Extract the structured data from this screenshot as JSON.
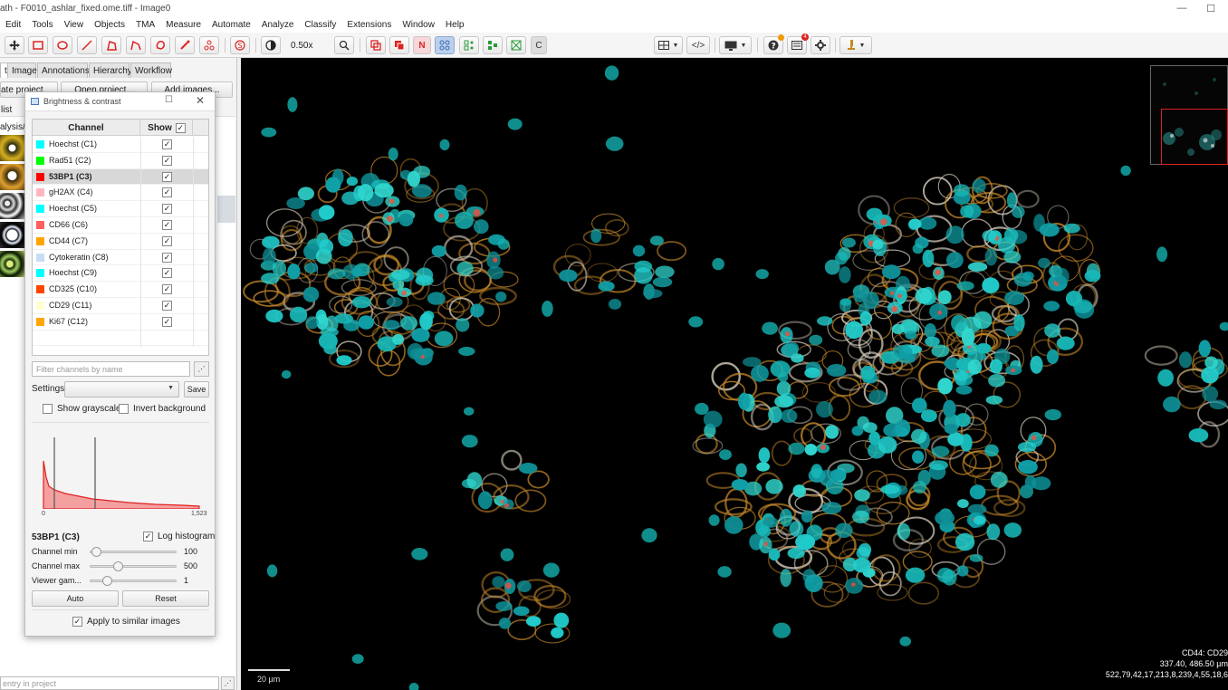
{
  "window": {
    "title": "ath - F0010_ashlar_fixed.ome.tiff - Image0",
    "minimize": "—",
    "maximize": "☐"
  },
  "menu": [
    "Edit",
    "Tools",
    "View",
    "Objects",
    "TMA",
    "Measure",
    "Automate",
    "Analyze",
    "Classify",
    "Extensions",
    "Window",
    "Help"
  ],
  "toolbar": {
    "zoom": "0.50x",
    "n_label": "N",
    "c_label": "C",
    "notify_badge": "4",
    "code_label": "</>"
  },
  "left_panel": {
    "tabs": [
      "t",
      "Image",
      "Annotations",
      "Hierarchy",
      "Workflow"
    ],
    "buttons": [
      "ate project...",
      "Open project...",
      "Add images..."
    ],
    "list_label": "list",
    "analysis_label": "alysis/p",
    "filter_placeholder": "entry in project",
    "filter_btn": "⋰"
  },
  "brightness_contrast": {
    "title": "Brightness & contrast",
    "maximize": "☐",
    "close": "✕",
    "col_channel": "Channel",
    "col_show": "Show",
    "channels": [
      {
        "name": "Hoechst (C1)",
        "color": "#00ffff",
        "show": true
      },
      {
        "name": "Rad51 (C2)",
        "color": "#00ff00",
        "show": true
      },
      {
        "name": "53BP1 (C3)",
        "color": "#ff0000",
        "show": true,
        "selected": true
      },
      {
        "name": "gH2AX (C4)",
        "color": "#ffb6c1",
        "show": true
      },
      {
        "name": "Hoechst (C5)",
        "color": "#00ffff",
        "show": true
      },
      {
        "name": "CD66 (C6)",
        "color": "#ff6060",
        "show": true
      },
      {
        "name": "CD44 (C7)",
        "color": "#ffa500",
        "show": true
      },
      {
        "name": "Cytokeratin (C8)",
        "color": "#c8dcf5",
        "show": true
      },
      {
        "name": "Hoechst (C9)",
        "color": "#00ffff",
        "show": true
      },
      {
        "name": "CD325 (C10)",
        "color": "#ff4500",
        "show": true
      },
      {
        "name": "CD29 (C11)",
        "color": "#ffffd0",
        "show": true
      },
      {
        "name": "Ki67 (C12)",
        "color": "#ffa500",
        "show": true
      }
    ],
    "check": "✓",
    "filter_placeholder": "Filter channels by name",
    "filter_btn": "⋰",
    "settings_label": "Settings",
    "settings_value": "",
    "save_label": "Save",
    "show_grayscale": "Show grayscale",
    "invert_background": "Invert background",
    "hist_min_label": "0",
    "hist_max_label": "1,523",
    "selected_channel": "53BP1 (C3)",
    "log_histogram": "Log histogram",
    "channel_min_label": "Channel min",
    "channel_min": "100",
    "channel_max_label": "Channel max",
    "channel_max": "500",
    "gamma_label": "Viewer gam...",
    "gamma": "1",
    "auto_label": "Auto",
    "reset_label": "Reset",
    "apply_similar": "Apply to similar images"
  },
  "viewer": {
    "scale_label": "20 µm",
    "info_line1": "CD44: CD29",
    "info_line2": "337.40, 486.50 µm",
    "info_line3": "522,79,42,17,213,8,239,4,55,18,6"
  }
}
